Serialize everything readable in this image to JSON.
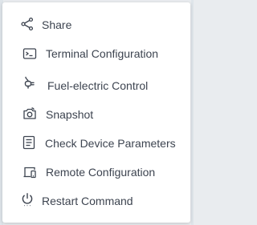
{
  "context_menu": {
    "items": [
      {
        "label": "Share",
        "icon": "share-icon"
      },
      {
        "label": "Terminal Configuration",
        "icon": "terminal-icon"
      },
      {
        "label": "Fuel-electric Control",
        "icon": "plug-icon"
      },
      {
        "label": "Snapshot",
        "icon": "camera-icon"
      },
      {
        "label": "Check Device Parameters",
        "icon": "document-list-icon"
      },
      {
        "label": "Remote Configuration",
        "icon": "devices-icon"
      },
      {
        "label": "Restart Command",
        "icon": "power-icon"
      }
    ],
    "text_color": "#3d4450",
    "icon_color": "#3d4450",
    "background_color": "#ffffff"
  }
}
